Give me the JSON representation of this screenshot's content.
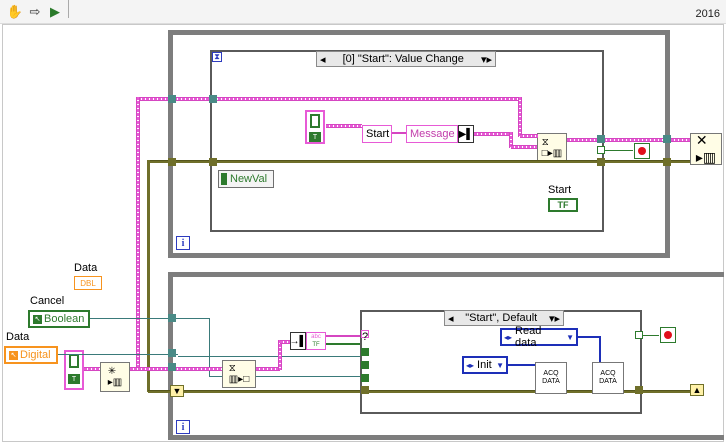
{
  "toolbar": {
    "version": "2016",
    "icons": [
      "hand-icon",
      "step-arrow-icon",
      "highlight-icon"
    ]
  },
  "event_structure": {
    "selector": "[0] \"Start\": Value Change",
    "newval_label": "NewVal",
    "start_indicator_label": "Start",
    "start_indicator_value": "TF"
  },
  "message": {
    "start_const": "Start",
    "message_label": "Message"
  },
  "case_structure": {
    "selector": "\"Start\", Default",
    "read_data_label": "Read data",
    "init_label": "Init"
  },
  "controls": {
    "data_dbl_label": "Data",
    "data_dbl_type": "DBL",
    "cancel_label": "Cancel",
    "cancel_type": "Boolean",
    "data_digital_label": "Data",
    "data_digital_type": "Digital"
  },
  "subvi": {
    "acq_text_top": "ACQ",
    "acq_text_bottom": "DATA"
  },
  "loop_iteration": "i",
  "colors": {
    "event_wire": "#e75ad6",
    "error_wire": "#6f6f2a",
    "loop_border": "#7d7d7d",
    "boolean_green": "#2d7a2d",
    "enum_blue": "#1d2fb8",
    "numeric_orange": "#f7931e"
  }
}
